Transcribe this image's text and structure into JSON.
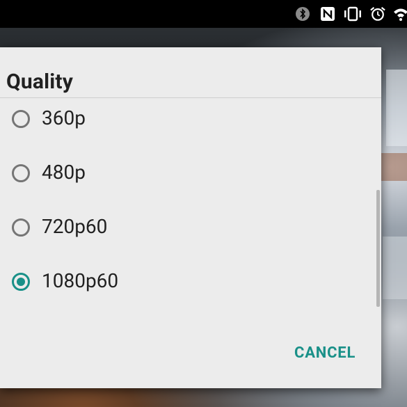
{
  "status_bar": {
    "icons": [
      "bluetooth-icon",
      "nfc-icon",
      "vibrate-icon",
      "alarm-icon",
      "wifi-icon"
    ]
  },
  "dialog": {
    "title": "Quality",
    "options": [
      {
        "label": "360p",
        "selected": false
      },
      {
        "label": "480p",
        "selected": false
      },
      {
        "label": "720p60",
        "selected": false
      },
      {
        "label": "1080p60",
        "selected": true
      }
    ],
    "cancel_label": "CANCEL"
  },
  "colors": {
    "accent": "#199088",
    "dialog_bg": "#ececec",
    "text": "#212121",
    "radio_unchecked": "#757575"
  }
}
